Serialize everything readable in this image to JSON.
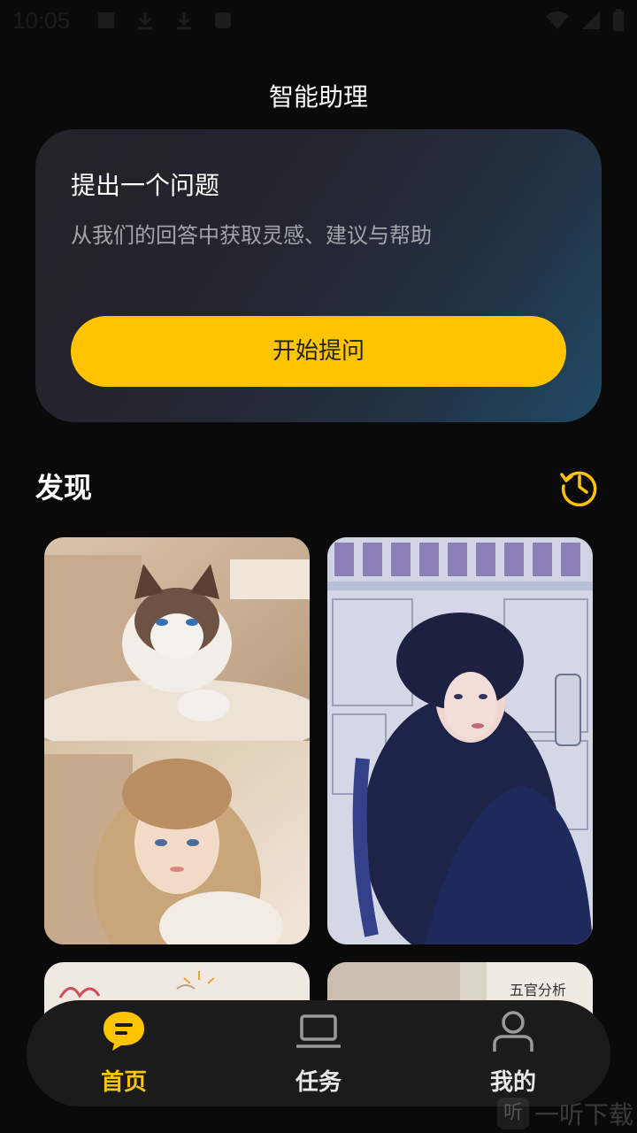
{
  "status_bar": {
    "time": "10:05",
    "icons": [
      "image-icon",
      "download-icon",
      "download-icon",
      "a-icon",
      "wifi-icon",
      "signal-icon",
      "battery-icon"
    ]
  },
  "header": {
    "title": "智能助理"
  },
  "ask_card": {
    "title": "提出一个问题",
    "subtitle": "从我们的回答中获取灵感、建议与帮助",
    "button_label": "开始提问"
  },
  "discover": {
    "title": "发现",
    "cards": [
      {
        "kind": "cat-and-girl-photo"
      },
      {
        "kind": "girl-with-manga-wall-photo"
      },
      {
        "kind": "handwritten-note-photo"
      },
      {
        "kind": "face-analysis",
        "caption": "五官分析"
      }
    ]
  },
  "nav": {
    "items": [
      {
        "label": "首页",
        "icon": "chat-bubble-icon",
        "active": true
      },
      {
        "label": "任务",
        "icon": "laptop-icon",
        "active": false
      },
      {
        "label": "我的",
        "icon": "person-icon",
        "active": false
      }
    ]
  },
  "colors": {
    "accent": "#ffc400",
    "background": "#0a0a0a",
    "nav_bg": "#1b1b1b",
    "inactive": "#9a9a9a"
  },
  "watermark": {
    "text": "一听下载",
    "badge": "听"
  }
}
